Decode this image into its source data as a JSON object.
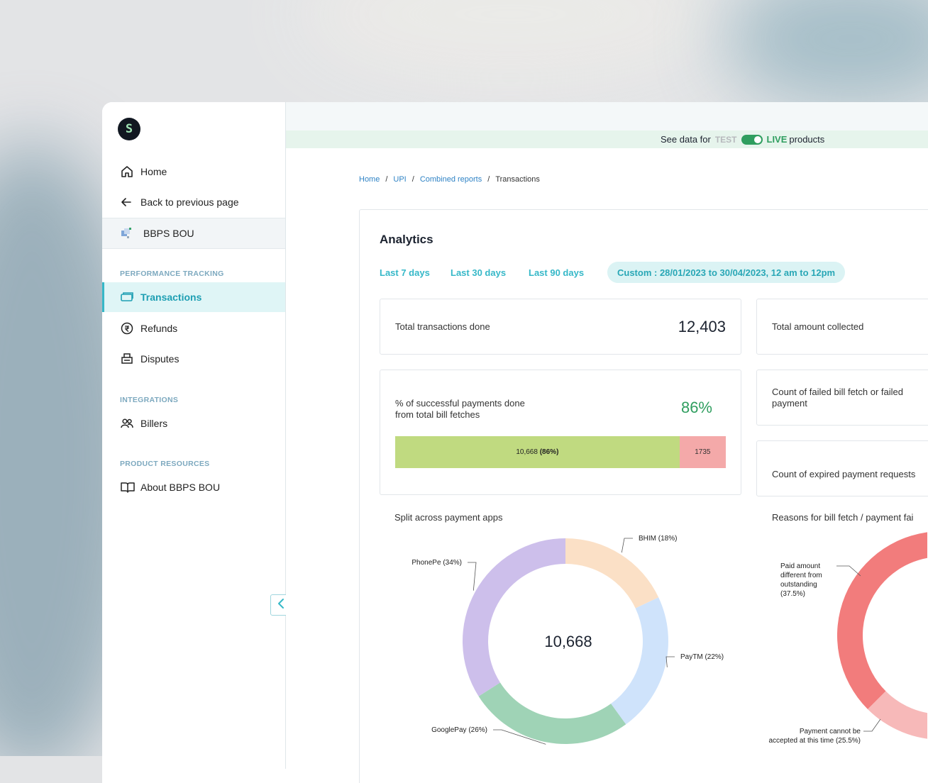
{
  "logo_glyph": "S",
  "sidebar": {
    "home": "Home",
    "back": "Back to previous page",
    "product": "BBPS BOU",
    "sections": {
      "performance": "PERFORMANCE TRACKING",
      "integrations": "INTEGRATIONS",
      "resources": "PRODUCT RESOURCES"
    },
    "items": {
      "transactions": "Transactions",
      "refunds": "Refunds",
      "disputes": "Disputes",
      "billers": "Billers",
      "about": "About BBPS BOU"
    },
    "active_item": "Transactions"
  },
  "env_toggle": {
    "prefix": "See data for",
    "test": "TEST",
    "live": "LIVE",
    "suffix": "products",
    "state": "LIVE"
  },
  "breadcrumb": {
    "items": [
      "Home",
      "UPI",
      "Combined reports"
    ],
    "current": "Transactions",
    "separator": "/"
  },
  "analytics": {
    "title": "Analytics",
    "ranges": [
      "Last 7 days",
      "Last 30 days",
      "Last 90 days"
    ],
    "custom_range": "Custom : 28/01/2023 to 30/04/2023, 12 am to 12pm",
    "total_transactions": {
      "label": "Total transactions done",
      "value": "12,403"
    },
    "total_amount": {
      "label": "Total amount collected"
    },
    "success_pct": {
      "label_line1": "% of successful payments done",
      "label_line2": "from total bill fetches",
      "value": "86%",
      "bar_success_count": "10,668",
      "bar_success_pct": "(86%)",
      "bar_fail_count": "1735",
      "success_fraction": 0.86
    },
    "failed_count": {
      "label_line1": "Count of failed bill fetch or failed",
      "label_line2": "payment"
    },
    "expired_count": {
      "label": "Count of expired payment requests"
    }
  },
  "chart_data": [
    {
      "type": "pie",
      "title": "Split across payment apps",
      "center_label": "10,668",
      "slices": [
        {
          "label": "BHIM (18%)",
          "value": 18,
          "color": "#fbe0c6"
        },
        {
          "label": "PayTM (22%)",
          "value": 22,
          "color": "#cfe3fb"
        },
        {
          "label": "GooglePay (26%)",
          "value": 26,
          "color": "#9fd3b6"
        },
        {
          "label": "PhonePe (34%)",
          "value": 34,
          "color": "#cdbfeb"
        }
      ]
    },
    {
      "type": "pie",
      "title": "Reasons for bill fetch / payment fai",
      "slices": [
        {
          "label_lines": [
            "Paid amount",
            "different from",
            "outstanding",
            "(37.5%)"
          ],
          "value": 37.5,
          "color": "#f27c7c"
        },
        {
          "label_lines": [
            "Payment cannot be",
            "accepted at this time (25.5%)"
          ],
          "value": 25.5,
          "color": "#f7b9b9"
        }
      ]
    }
  ]
}
